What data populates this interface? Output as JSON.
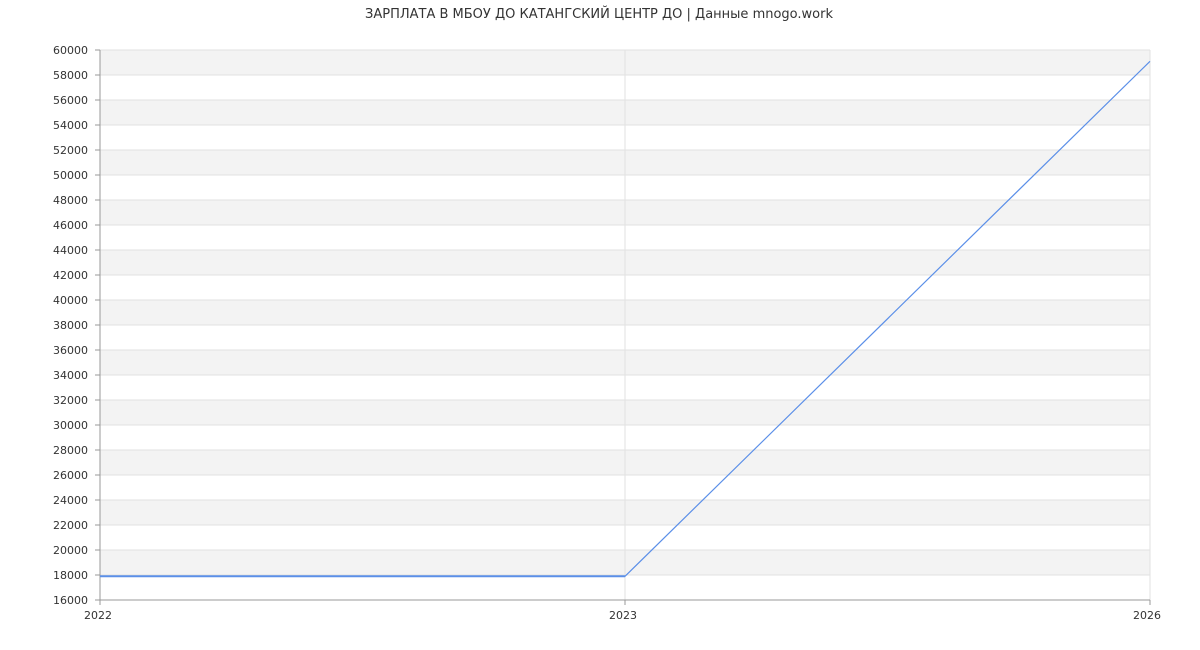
{
  "chart_data": {
    "type": "line",
    "title": "ЗАРПЛАТА В МБОУ ДО КАТАНГСКИЙ ЦЕНТР ДО | Данные mnogo.work",
    "xlabel": "",
    "ylabel": "",
    "x": [
      2022,
      2023,
      2026
    ],
    "x_tick_labels": [
      "2022",
      "2023",
      "2026"
    ],
    "xlim": [
      2022,
      2026
    ],
    "x_tick_positions": [
      0,
      0.5,
      1
    ],
    "ylim": [
      16000,
      60000
    ],
    "y_ticks": [
      16000,
      18000,
      20000,
      22000,
      24000,
      26000,
      28000,
      30000,
      32000,
      34000,
      36000,
      38000,
      40000,
      42000,
      44000,
      46000,
      48000,
      50000,
      52000,
      54000,
      56000,
      58000,
      60000
    ],
    "series": [
      {
        "values": [
          17900,
          17900,
          59100
        ],
        "color": "#5b8fe8"
      }
    ],
    "grid": true,
    "band_color": "#f3f3f3",
    "grid_color": "#e2e2e2",
    "axis_color": "#999999"
  }
}
